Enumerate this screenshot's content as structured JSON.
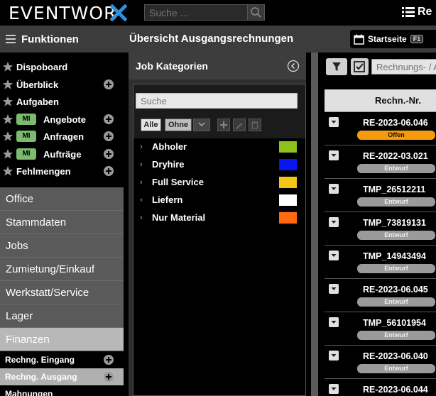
{
  "app": {
    "logo_text": "EVENTWOR",
    "search_placeholder": "Suche ...",
    "top_right_label": "Re"
  },
  "sidebar": {
    "header": "Funktionen",
    "favorites": [
      {
        "label": "Dispoboard",
        "badge": "",
        "plus": false
      },
      {
        "label": "Überblick",
        "badge": "",
        "plus": true
      },
      {
        "label": "Aufgaben",
        "badge": "",
        "plus": false
      },
      {
        "label": "Angebote",
        "badge": "MI",
        "plus": true
      },
      {
        "label": "Anfragen",
        "badge": "MI",
        "plus": true
      },
      {
        "label": "Aufträge",
        "badge": "MI",
        "plus": true
      },
      {
        "label": "Fehlmengen",
        "badge": "",
        "plus": true
      }
    ],
    "nav": [
      "Office",
      "Stammdaten",
      "Jobs",
      "Zumietung/Einkauf",
      "Werkstatt/Service",
      "Lager",
      "Finanzen"
    ],
    "sub": [
      "Rechng. Eingang",
      "Rechng. Ausgang",
      "Mahnungen"
    ]
  },
  "main": {
    "title": "Übersicht Ausgangsrechnungen",
    "start_label": "Startseite",
    "start_key": "F1"
  },
  "jobcat": {
    "title": "Job Kategorien",
    "search_placeholder": "Suche",
    "all_label": "Alle",
    "none_label": "Ohne",
    "items": [
      {
        "name": "Abholer",
        "color": "#8cc21a"
      },
      {
        "name": "Dryhire",
        "color": "#0a14f0"
      },
      {
        "name": "Full Service",
        "color": "#f5c518"
      },
      {
        "name": "Liefern",
        "color": "#ffffff"
      },
      {
        "name": "Nur Material",
        "color": "#ff6a10"
      }
    ]
  },
  "grid": {
    "search_placeholder": "Rechnungs- / A",
    "col_header": "Rechn.-Nr.",
    "rows": [
      {
        "nr": "RE-2023-06.046",
        "status": "Offen"
      },
      {
        "nr": "RE-2022-03.021",
        "status": "Entwurf"
      },
      {
        "nr": "TMP_26512211",
        "status": "Entwurf"
      },
      {
        "nr": "TMP_73819131",
        "status": "Entwurf"
      },
      {
        "nr": "TMP_14943494",
        "status": "Entwurf"
      },
      {
        "nr": "RE-2023-06.045",
        "status": "Entwurf"
      },
      {
        "nr": "TMP_56101954",
        "status": "Entwurf"
      },
      {
        "nr": "RE-2023-06.040",
        "status": "Entwurf"
      },
      {
        "nr": "RE-2023-06.044",
        "status": ""
      }
    ]
  },
  "colors": {
    "accent_blue": "#2f8fd8",
    "badge_green": "#7cba6f",
    "status_open": "#f59a0d",
    "status_draft": "#9a9a9a"
  }
}
